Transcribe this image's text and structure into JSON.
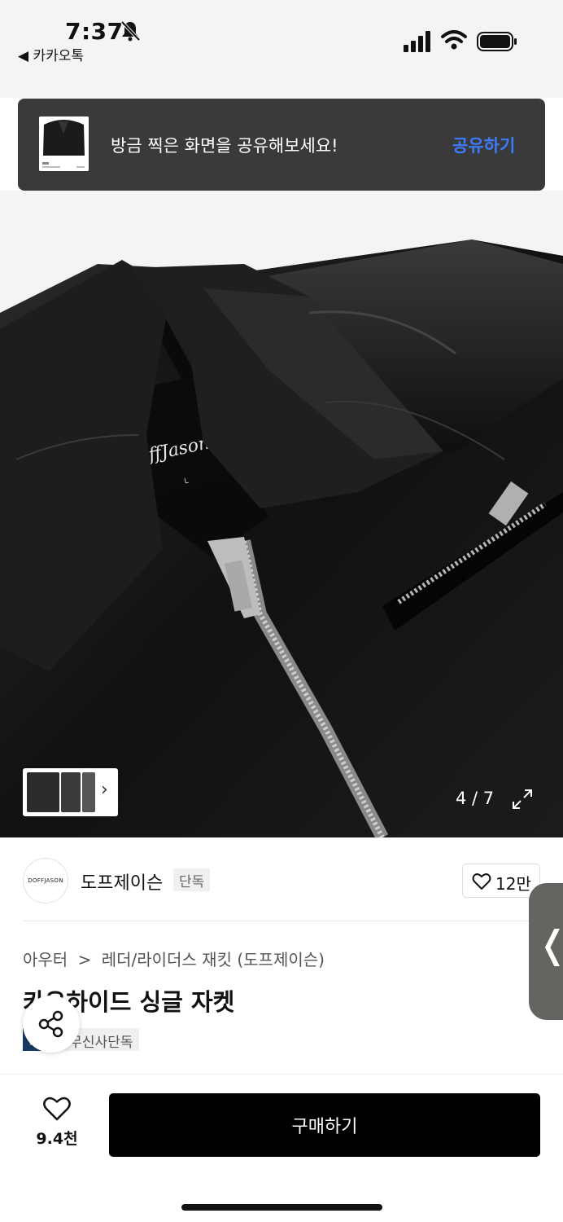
{
  "status_bar": {
    "time": "7:37",
    "back_app": "◀ 카카오톡",
    "icons": [
      "bell-slash-icon",
      "cellular-signal-icon",
      "wifi-icon",
      "battery-icon"
    ]
  },
  "share_banner": {
    "message": "방금 찍은 화면을 공유해보세요!",
    "action_label": "공유하기",
    "action_color": "#3d7bf7"
  },
  "gallery": {
    "label_text": "DoffJason",
    "label_size": "L",
    "page_indicator": "4 / 7",
    "current_page": 4,
    "total_pages": 7
  },
  "brand": {
    "logo_text": "DOFFJASON",
    "name": "도프제이슨",
    "tag": "단독",
    "like_count": "12만"
  },
  "product": {
    "breadcrumb": [
      "아우터",
      ">",
      "레더/라이더스 재킷 (도프제이슨)"
    ],
    "title": "카우하이드 싱글 자켓",
    "badges": [
      "페이",
      "무신사단독"
    ],
    "badge_colors": [
      "#183a62",
      "#f0f0f0"
    ]
  },
  "bottom_bar": {
    "wish_count": "9.4천",
    "buy_label": "구매하기"
  }
}
